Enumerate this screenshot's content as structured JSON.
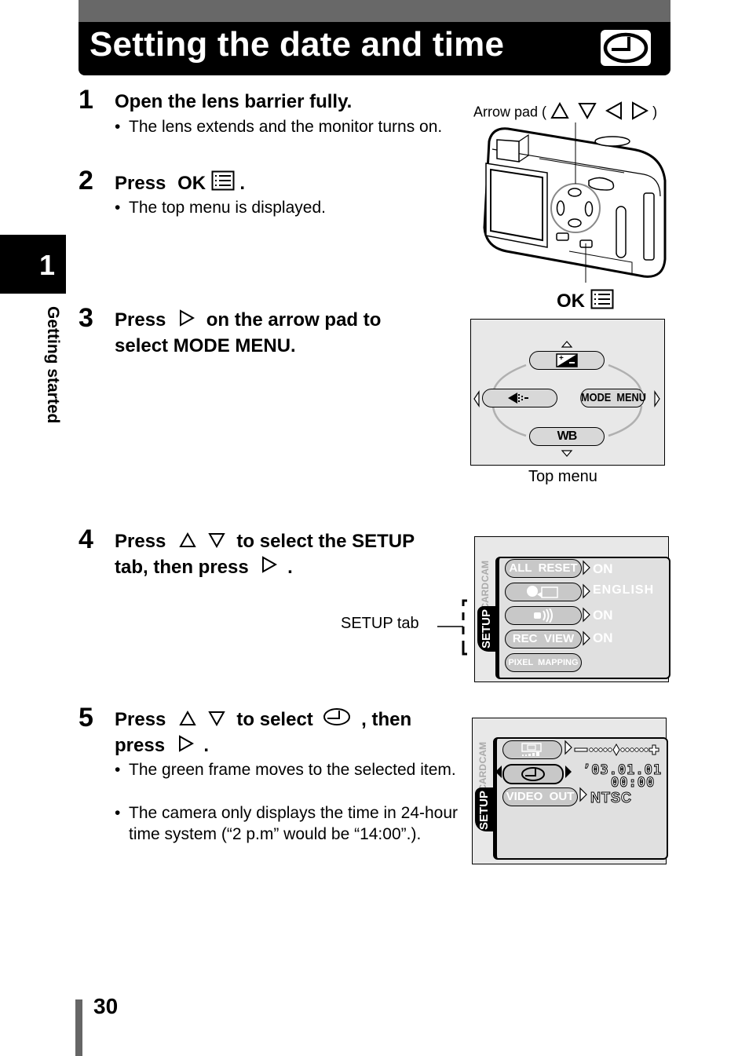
{
  "header": {
    "title": "Setting the date and time",
    "icon": "clock-icon"
  },
  "chapter": {
    "number": "1",
    "label": "Getting started"
  },
  "steps": [
    {
      "number": "1",
      "heading": "Open the lens barrier fully.",
      "bullets": [
        "The lens extends and the monitor turns on."
      ]
    },
    {
      "number": "2",
      "heading_prefix": "Press",
      "heading_key": "OK",
      "heading_suffix": ".",
      "bullets": [
        "The top menu is displayed."
      ]
    },
    {
      "number": "3",
      "heading_prefix": "Press",
      "heading_suffix_line1": "on the arrow pad to",
      "heading_line2": "select MODE MENU."
    },
    {
      "number": "4",
      "heading_prefix": "Press",
      "heading_suffix_line1": "to select the SETUP",
      "heading_line2_prefix": "tab, then press",
      "heading_line2_suffix": "."
    },
    {
      "number": "5",
      "heading_prefix": "Press",
      "heading_mid": "to select",
      "heading_suffix": ", then",
      "heading_line2_prefix": "press",
      "heading_line2_suffix": ".",
      "bullets": [
        "The green frame moves to the selected item.",
        "The camera only displays the time in 24-hour time system (“2 p.m” would be “14:00”.)."
      ]
    }
  ],
  "camera_figure": {
    "arrow_pad_label_prefix": "Arrow pad (",
    "arrow_pad_label_suffix": ")",
    "ok_label": "OK"
  },
  "top_menu_figure": {
    "caption": "Top menu",
    "items": {
      "top": "exposure-compensation-icon",
      "left": "flash-mode-icon",
      "right": "MODE  MENU",
      "bottom": "WB"
    }
  },
  "setup_figure": {
    "callout": "SETUP tab",
    "tabs": [
      "CAM",
      "CARD",
      "SETUP"
    ],
    "rows": [
      {
        "label": "ALL  RESET",
        "value": "ON"
      },
      {
        "label": "language-icon",
        "value": "ENGLISH"
      },
      {
        "label": "beep-icon",
        "value": "ON"
      },
      {
        "label": "REC  VIEW",
        "value": "ON"
      },
      {
        "label": "PIXEL  MAPPING",
        "value": ""
      }
    ]
  },
  "datetime_figure": {
    "tabs": [
      "CAM",
      "CARD",
      "SETUP"
    ],
    "rows": [
      {
        "label": "monitor-brightness-icon",
        "value": "brightness-slider"
      },
      {
        "label": "clock-icon",
        "value_date": "’03.01.01",
        "value_time": "00:00"
      },
      {
        "label": "VIDEO  OUT",
        "value": "NTSC"
      }
    ],
    "brightness_level": 0.5
  },
  "footer": {
    "page_number": "30"
  }
}
